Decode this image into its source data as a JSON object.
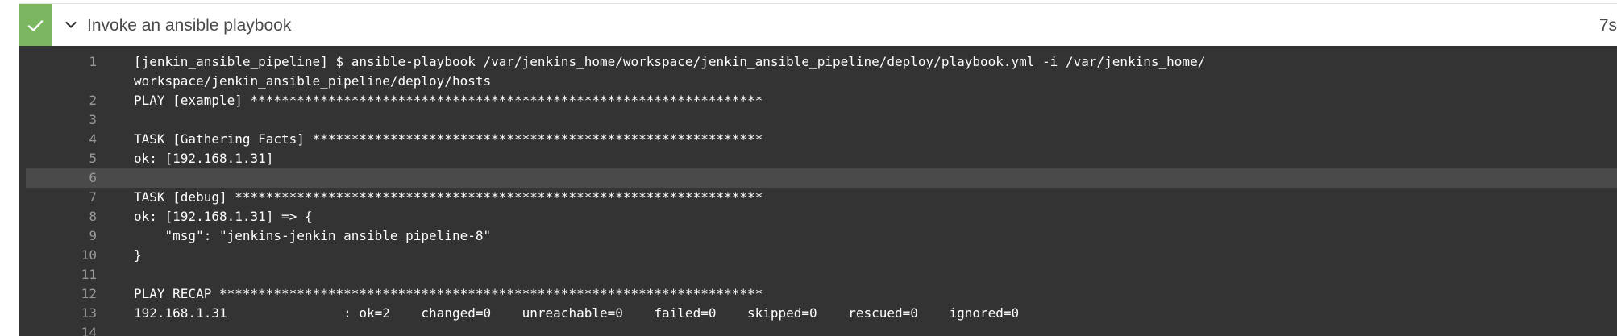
{
  "stage": {
    "status": "success",
    "status_color": "#7bb661",
    "status_icon": "check-icon",
    "toggle_icon": "chevron-down-icon",
    "title": "Invoke an ansible playbook",
    "duration": "7s"
  },
  "console": {
    "background": "#333333",
    "highlighted_line": "6",
    "lines": [
      {
        "num": "1",
        "text": "[jenkin_ansible_pipeline] $ ansible-playbook /var/jenkins_home/workspace/jenkin_ansible_pipeline/deploy/playbook.yml -i /var/jenkins_home/workspace/jenkin_ansible_pipeline/deploy/hosts"
      },
      {
        "num": "2",
        "text": "PLAY [example] ******************************************************************"
      },
      {
        "num": "3",
        "text": ""
      },
      {
        "num": "4",
        "text": "TASK [Gathering Facts] **********************************************************"
      },
      {
        "num": "5",
        "text": "ok: [192.168.1.31]"
      },
      {
        "num": "6",
        "text": ""
      },
      {
        "num": "7",
        "text": "TASK [debug] ********************************************************************"
      },
      {
        "num": "8",
        "text": "ok: [192.168.1.31] => {"
      },
      {
        "num": "9",
        "text": "    \"msg\": \"jenkins-jenkin_ansible_pipeline-8\""
      },
      {
        "num": "10",
        "text": "}"
      },
      {
        "num": "11",
        "text": ""
      },
      {
        "num": "12",
        "text": "PLAY RECAP **********************************************************************"
      },
      {
        "num": "13",
        "text": "192.168.1.31               : ok=2    changed=0    unreachable=0    failed=0    skipped=0    rescued=0    ignored=0"
      },
      {
        "num": "14",
        "text": ""
      }
    ]
  }
}
